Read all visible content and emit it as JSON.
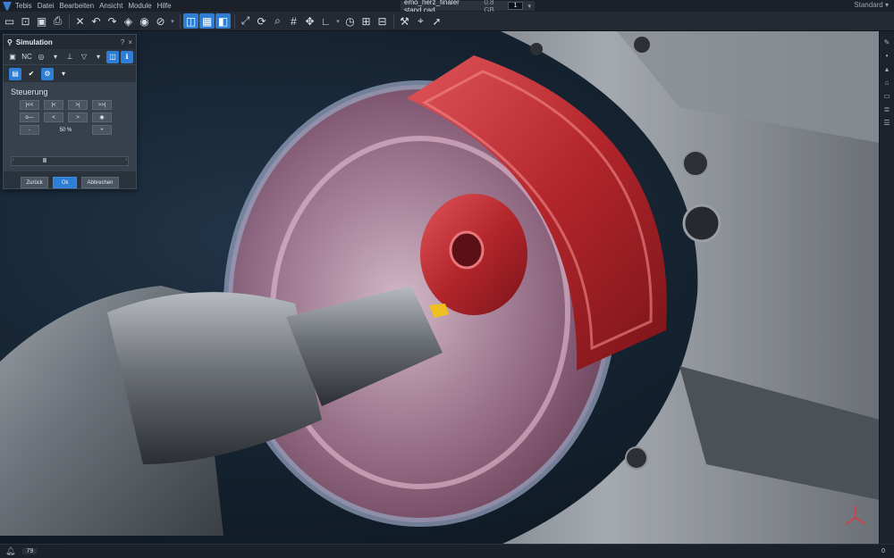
{
  "menu": [
    "Tebis",
    "Datei",
    "Bearbeiten",
    "Ansicht",
    "Module",
    "Hilfe"
  ],
  "document": {
    "filename": "emo_herz_finaler stand.cad",
    "size": "0.8 GB",
    "window_number": "1"
  },
  "profile": "Standard",
  "simulation_panel": {
    "title": "Simulation",
    "help": "?",
    "close": "×",
    "tool_nc_label": "NC",
    "section": "Steuerung",
    "controls": {
      "first": "|<<",
      "prev_step": "|<",
      "next_step": ">|",
      "last": ">>|",
      "back": "o—",
      "prev": "<",
      "next": ">",
      "record": "◉"
    },
    "speed": {
      "minus": "-",
      "value": "50 %",
      "plus": "+"
    },
    "slider": {
      "value": 0.27
    },
    "buttons": {
      "back": "Zurück",
      "ok": "Ok",
      "cancel": "Abbrechen"
    }
  },
  "status": {
    "left_count": "79",
    "right_count": "0"
  }
}
